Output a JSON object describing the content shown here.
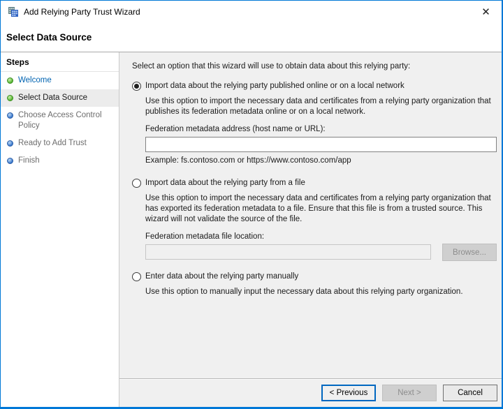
{
  "window": {
    "title": "Add Relying Party Trust Wizard",
    "close_glyph": "✕"
  },
  "page": {
    "heading": "Select Data Source"
  },
  "sidebar": {
    "heading": "Steps",
    "items": [
      {
        "label": "Welcome",
        "state": "done",
        "current": false
      },
      {
        "label": "Select Data Source",
        "state": "done",
        "current": true
      },
      {
        "label": "Choose Access Control Policy",
        "state": "todo",
        "current": false
      },
      {
        "label": "Ready to Add Trust",
        "state": "todo",
        "current": false
      },
      {
        "label": "Finish",
        "state": "todo",
        "current": false
      }
    ]
  },
  "main": {
    "instruction": "Select an option that this wizard will use to obtain data about this relying party:",
    "options": [
      {
        "label": "Import data about the relying party published online or on a local network",
        "selected": true,
        "description": "Use this option to import the necessary data and certificates from a relying party organization that publishes its federation metadata online or on a local network.",
        "field_label": "Federation metadata address (host name or URL):",
        "field_value": "",
        "example": "Example: fs.contoso.com or https://www.contoso.com/app"
      },
      {
        "label": "Import data about the relying party from a file",
        "selected": false,
        "description": "Use this option to import the necessary data and certificates from a relying party organization that has exported its federation metadata to a file. Ensure that this file is from a trusted source.  This wizard will not validate the source of the file.",
        "field_label": "Federation metadata file location:",
        "field_value": "",
        "browse_label": "Browse..."
      },
      {
        "label": "Enter data about the relying party manually",
        "selected": false,
        "description": "Use this option to manually input the necessary data about this relying party organization."
      }
    ]
  },
  "footer": {
    "previous_label": "< Previous",
    "next_label": "Next >",
    "cancel_label": "Cancel"
  },
  "colors": {
    "accent_border": "#0078d7",
    "step_link": "#0063b1",
    "bullet_done": "#4caf2a",
    "bullet_todo": "#2f6fc8",
    "main_background": "#f0f0f0",
    "focused_button_border": "#0067c0"
  }
}
